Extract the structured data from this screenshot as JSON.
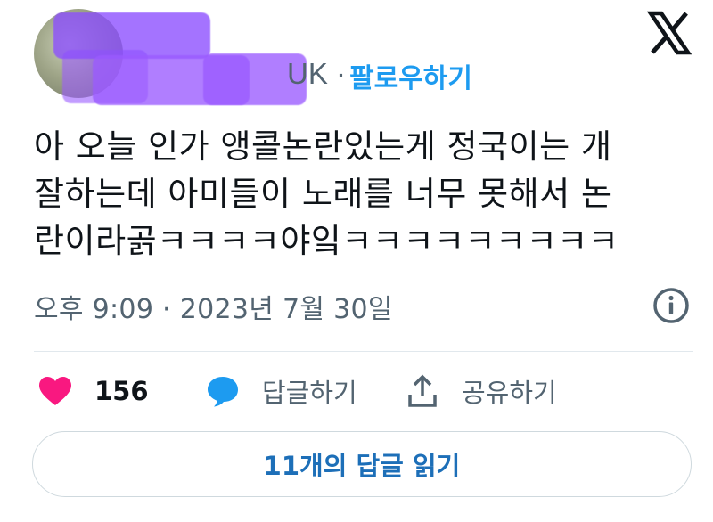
{
  "header": {
    "handle_suffix": "UK ·",
    "follow_label": "팔로우하기",
    "logo_icon": "x-logo-icon"
  },
  "tweet": {
    "lines": [
      "아 오늘 인가 앵콜논란있는게 정국이는 개",
      "잘하는데 아미들이 노래를 너무 못해서 논",
      "란이라곩ㅋㅋㅋㅋ야잌ㅋㅋㅋㅋㅋㅋㅋㅋㅋ"
    ],
    "timestamp": "오후 9:09 · 2023년 7월 30일"
  },
  "actions": {
    "like_count": "156",
    "reply_label": "답글하기",
    "share_label": "공유하기"
  },
  "replies_button": {
    "label": "11개의 답글 읽기"
  },
  "colors": {
    "accent": "#1d9bf0",
    "like": "#f91880",
    "redaction": "#9b5bff"
  }
}
